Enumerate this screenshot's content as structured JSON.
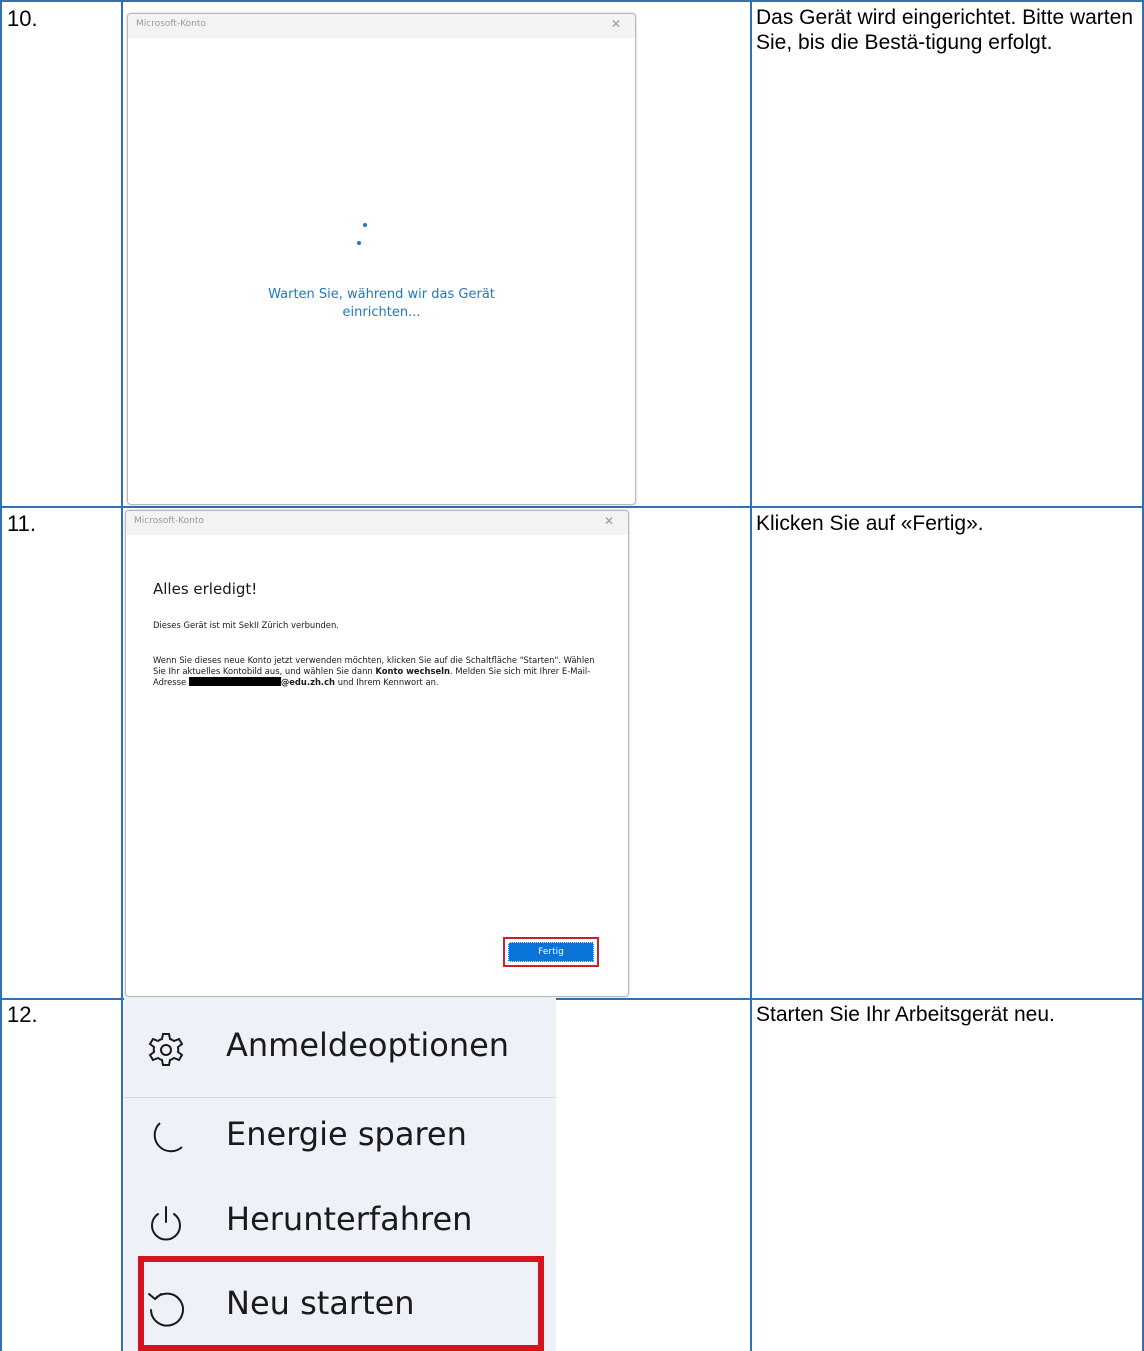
{
  "steps": [
    {
      "number": "10.",
      "description": "Das Gerät wird eingerichtet. Bitte warten Sie, bis die Bestä-tigung erfolgt."
    },
    {
      "number": "11.",
      "description": "Klicken Sie auf «Fertig»."
    },
    {
      "number": "12.",
      "description": "Starten Sie Ihr Arbeitsgerät neu."
    }
  ],
  "dialog10": {
    "title": "Microsoft-Konto",
    "close_glyph": "✕",
    "wait_line1": "Warten Sie, während wir das Gerät",
    "wait_line2": "einrichten..."
  },
  "dialog11": {
    "title": "Microsoft-Konto",
    "close_glyph": "✕",
    "heading": "Alles erledigt!",
    "connected_text": "Dieses Gerät ist mit SekII Zürich verbunden.",
    "instructions_part1": "Wenn Sie dieses neue Konto jetzt verwenden möchten, klicken Sie auf die Schaltfläche \"Starten\". Wählen Sie Ihr aktuelles Kontobild aus, und wählen Sie dann",
    "instructions_bold1": "Konto wechseln",
    "instructions_part2": ". Melden Sie sich mit Ihrer E-Mail-Adresse",
    "instructions_email_domain": "@edu.zh.ch",
    "instructions_part3": "und Ihrem Kennwort an.",
    "button_label": "Fertig",
    "accent_color": "#0a74d8",
    "highlight_color": "#d0202a"
  },
  "power_menu": {
    "items": [
      {
        "label": "Anmeldeoptionen",
        "icon": "gear-icon"
      },
      {
        "label": "Energie sparen",
        "icon": "moon-icon"
      },
      {
        "label": "Herunterfahren",
        "icon": "power-icon"
      },
      {
        "label": "Neu starten",
        "icon": "restart-icon"
      }
    ],
    "highlight_color": "#d6141e"
  }
}
